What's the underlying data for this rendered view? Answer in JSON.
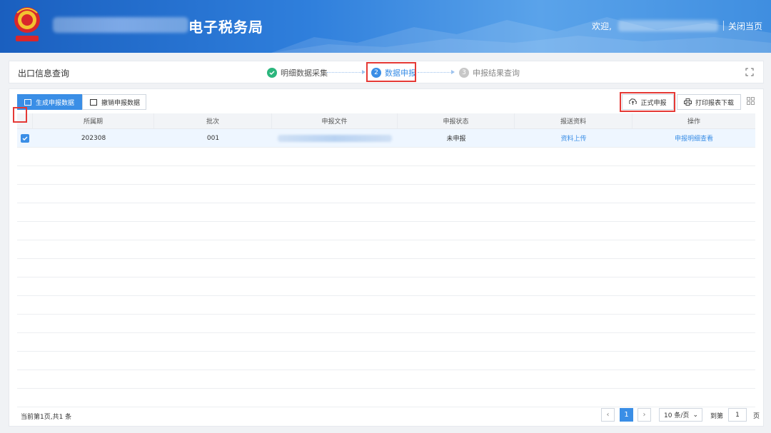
{
  "header": {
    "org_name": "",
    "title": "电子税务局",
    "welcome": "欢迎,",
    "username": "",
    "close_page": "关闭当页"
  },
  "stepbar": {
    "page_name": "出口信息查询",
    "steps": [
      {
        "label": "明细数据采集",
        "state": "done",
        "icon": "check-icon"
      },
      {
        "label": "数据申报",
        "state": "current",
        "number": "2"
      },
      {
        "label": "申报结果查询",
        "state": "pending",
        "number": "3"
      }
    ]
  },
  "toolbar": {
    "generate_tab": "生成申报数据",
    "undo_tab": "撤销申报数据",
    "submit_button": "正式申报",
    "print_button": "打印报表下载"
  },
  "table": {
    "columns": [
      "所属期",
      "批次",
      "申报文件",
      "申报状态",
      "报送资料",
      "操作"
    ],
    "rows": [
      {
        "period": "202308",
        "batch": "001",
        "file": "",
        "status": "未申报",
        "material": "资料上传",
        "action": "申报明细查看",
        "checked": true
      }
    ]
  },
  "pagination": {
    "info": "当前第1页,共1 条",
    "current_page": "1",
    "page_size": "10 条/页",
    "goto_label": "到第",
    "goto_value": "1",
    "page_unit": "页"
  },
  "colors": {
    "primary": "#3a8ee6",
    "success": "#2bb67d",
    "highlight": "#e53935",
    "header_bg": "#2f7fdc"
  }
}
